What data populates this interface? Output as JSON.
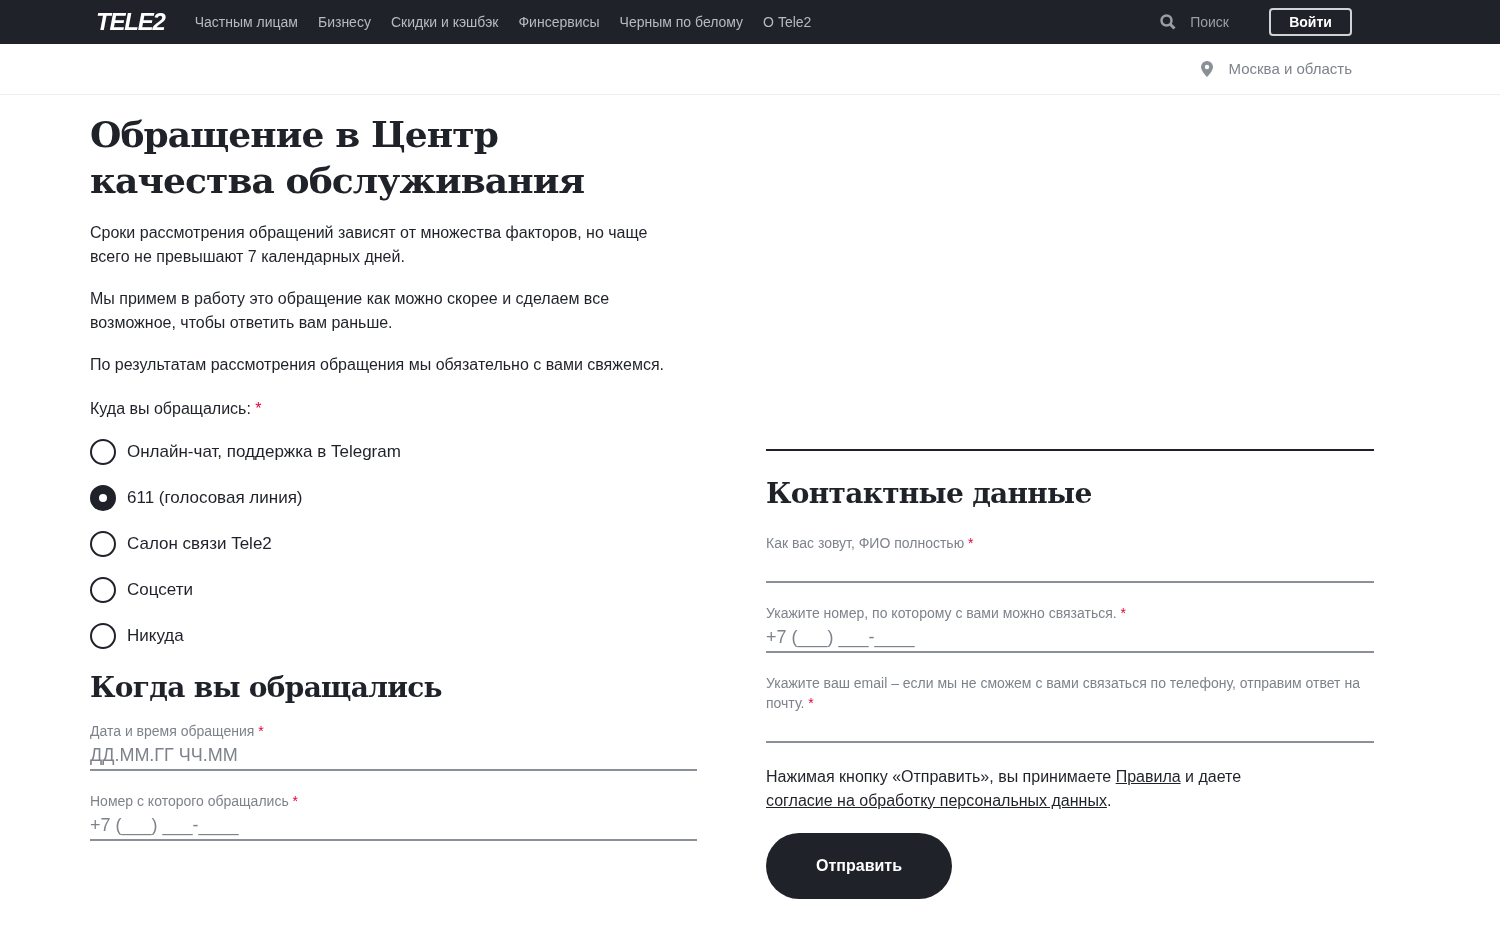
{
  "header": {
    "logo": "TELE2",
    "nav": [
      {
        "label": "Частным лицам"
      },
      {
        "label": "Бизнесу"
      },
      {
        "label": "Скидки и кэшбэк"
      },
      {
        "label": "Финсервисы"
      },
      {
        "label": "Черным по белому"
      },
      {
        "label": "О Tele2"
      }
    ],
    "search": "Поиск",
    "login": "Войти"
  },
  "region": "Москва и область",
  "title": "Обращение в Центр качества обслуживания",
  "paragraphs": [
    "Сроки рассмотрения обращений зависят от множества факторов, но чаще всего не превышают 7 календарных дней.",
    "Мы примем в работу это обращение как можно скорее и сделаем все возможное, чтобы ответить вам раньше.",
    "По результатам рассмотрения обращения мы обязательно с вами свяжемся."
  ],
  "where": {
    "label": "Куда вы обращались:",
    "required_mark": "*",
    "options": [
      {
        "label": "Онлайн-чат, поддержка в Telegram",
        "selected": false
      },
      {
        "label": "611 (голосовая линия)",
        "selected": true
      },
      {
        "label": "Салон связи Tele2",
        "selected": false
      },
      {
        "label": "Соцсети",
        "selected": false
      },
      {
        "label": "Никуда",
        "selected": false
      }
    ]
  },
  "when": {
    "title": "Когда вы обращались",
    "fields": [
      {
        "label": "Дата и время обращения",
        "required_mark": "*",
        "placeholder": "ДД.ММ.ГГ ЧЧ.ММ"
      },
      {
        "label": "Номер с которого обращались",
        "required_mark": "*",
        "placeholder": "+7 (___) ___-____"
      }
    ]
  },
  "contacts": {
    "title": "Контактные данные",
    "fields": [
      {
        "label": "Как вас зовут, ФИО полностью",
        "required_mark": "*"
      },
      {
        "label": "Укажите номер, по которому с вами можно связаться.",
        "required_mark": "*",
        "placeholder": "+7 (___) ___-____"
      },
      {
        "label": "Укажите ваш email – если мы не сможем с вами связаться по телефону, отправим ответ на почту.",
        "required_mark": "*"
      }
    ]
  },
  "consent": {
    "before": "Нажимая кнопку «Отправить», вы принимаете",
    "link1": "Правила",
    "middle": "и даете",
    "link2": "согласие на обработку персональных данных",
    "after": "."
  },
  "submit": "Отправить"
}
